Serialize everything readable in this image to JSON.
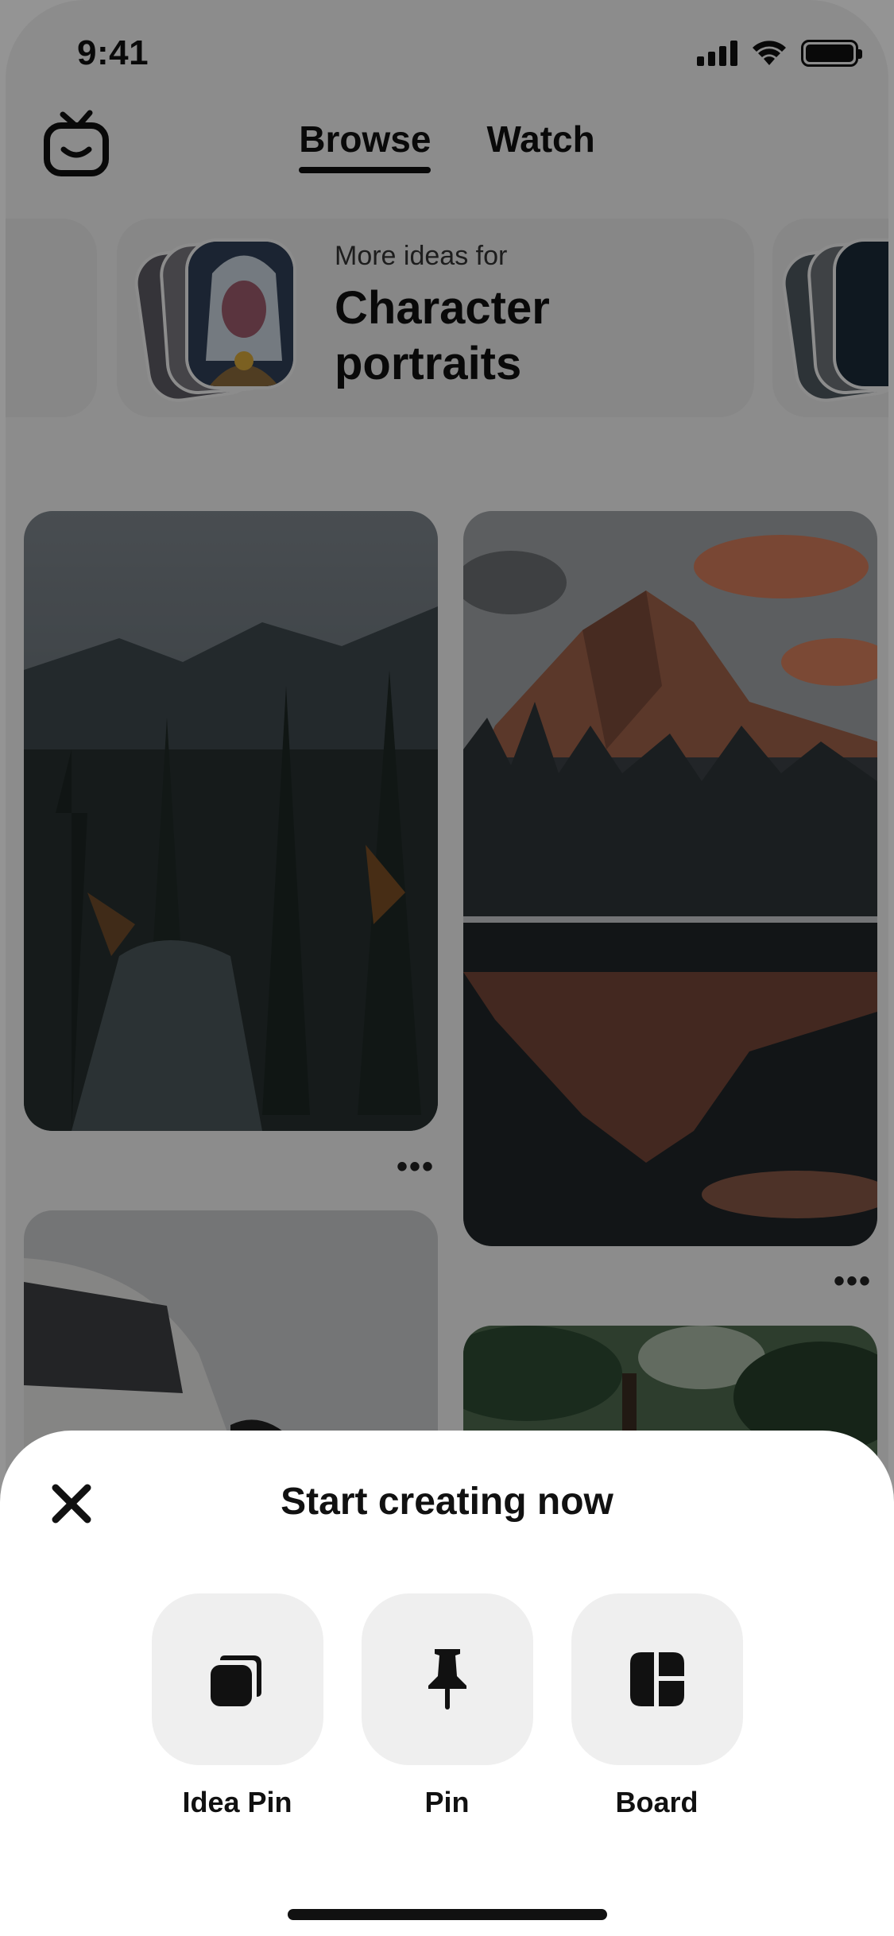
{
  "status_bar": {
    "time": "9:41"
  },
  "header": {
    "tabs": [
      {
        "label": "Browse",
        "active": true
      },
      {
        "label": "Watch",
        "active": false
      }
    ]
  },
  "idea_card": {
    "prefix": "More ideas for",
    "title_line1": "Character",
    "title_line2": "portraits"
  },
  "pins": {
    "more_label": "•••"
  },
  "sheet": {
    "title": "Start creating now",
    "options": [
      {
        "label": "Idea Pin",
        "icon": "idea-pin-icon"
      },
      {
        "label": "Pin",
        "icon": "pushpin-icon"
      },
      {
        "label": "Board",
        "icon": "board-icon"
      }
    ]
  },
  "colors": {
    "sheet_bg": "#ffffff",
    "option_bg": "#efefef",
    "overlay": "rgba(0,0,0,0.42)"
  }
}
